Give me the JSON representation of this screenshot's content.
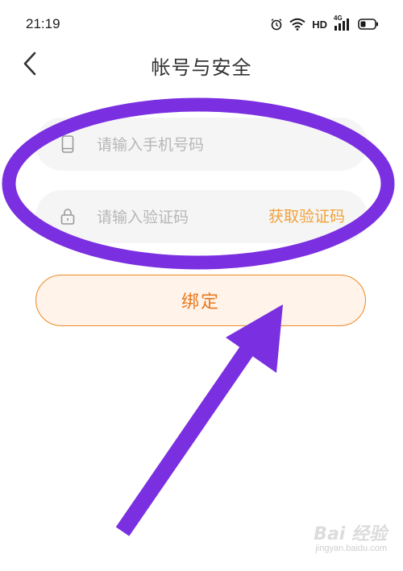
{
  "status_bar": {
    "time": "21:19",
    "hd_label": "HD",
    "network_label": "4G",
    "icons": [
      "alarm-icon",
      "wifi-icon",
      "signal-icon",
      "battery-icon"
    ]
  },
  "nav": {
    "title": "帐号与安全",
    "back_icon": "chevron-left-icon"
  },
  "form": {
    "phone_placeholder": "请输入手机号码",
    "phone_value": "",
    "code_placeholder": "请输入验证码",
    "code_value": "",
    "get_code_label": "获取验证码"
  },
  "bind_button": {
    "label": "绑定"
  },
  "colors": {
    "accent_orange": "#e8791f",
    "link_orange": "#f0a23a",
    "annotation_purple": "#7a2fe0",
    "field_bg": "#f5f5f5"
  },
  "watermark": {
    "logo_text": "Bai 经验",
    "url": "jingyan.baidu.com"
  }
}
